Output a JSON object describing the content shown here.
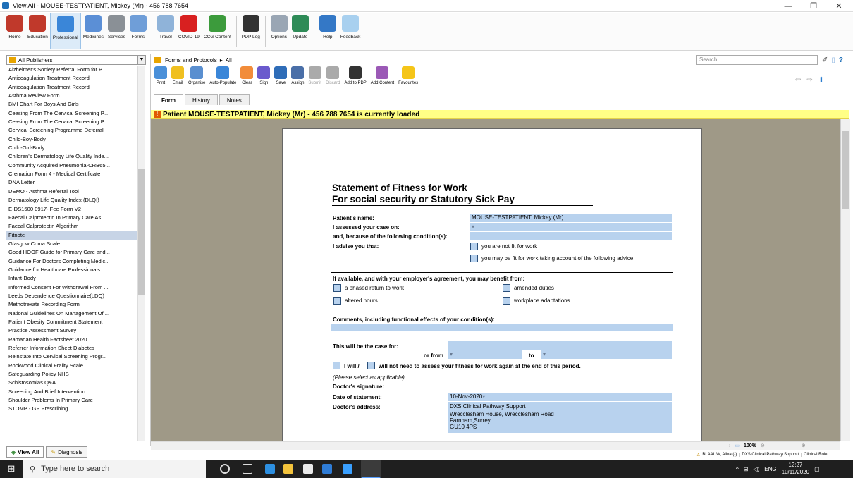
{
  "window": {
    "title": "View All  -  MOUSE-TESTPATIENT, Mickey (Mr) - 456 788 7654"
  },
  "ribbon": [
    {
      "label": "Home",
      "icon": "home-icon",
      "color": "#c0392b"
    },
    {
      "label": "Education",
      "icon": "education-icon",
      "color": "#c0392b"
    },
    {
      "label": "Professional",
      "icon": "caduceus-icon",
      "color": "#3a86d8",
      "active": true
    },
    {
      "label": "Medicines",
      "icon": "medicines-icon",
      "color": "#5b8fd6"
    },
    {
      "label": "Services",
      "icon": "ambulance-icon",
      "color": "#8a9096"
    },
    {
      "label": "Forms",
      "icon": "forms-icon",
      "color": "#6f9ed8"
    },
    {
      "label": "Travel",
      "icon": "travel-icon",
      "color": "#8fb3d9"
    },
    {
      "label": "COVID-19",
      "icon": "siren-icon",
      "color": "#d82020"
    },
    {
      "label": "CCG Content",
      "icon": "people-icon",
      "color": "#3c9b3c"
    },
    {
      "label": "PDP Log",
      "icon": "graduate-icon",
      "color": "#333333"
    },
    {
      "label": "Options",
      "icon": "tools-icon",
      "color": "#9aa6b4"
    },
    {
      "label": "Update",
      "icon": "update-icon",
      "color": "#2e8b57"
    },
    {
      "label": "Help",
      "icon": "help-icon",
      "color": "#3478c6"
    },
    {
      "label": "Feedback",
      "icon": "feedback-icon",
      "color": "#a8d0ef"
    }
  ],
  "left": {
    "publisher": "All Publishers",
    "forms": [
      "Alzheimer's Society Referral Form for P...",
      "Anticoagulation Treatment Record",
      "Anticoagulation Treatment Record",
      "Asthma Review Form",
      "BMI Chart For Boys And Girls",
      "Ceasing From The Cervical Screening P...",
      "Ceasing From The Cervical Screening P...",
      "Cervical Screening Programme Deferral",
      "Child-Boy-Body",
      "Child-Girl-Body",
      "Children's Dermatology Life Quality Inde...",
      "Community Acquired Pneumonia-CRB65...",
      "Cremation Form 4 - Medical Certificate",
      "DNA Letter",
      "DEMO - Asthma Referral Tool",
      "Dermatology Life Quality Index (DLQI)",
      "E-DS1500 0917- Fee Form V2",
      "Faecal Calprotectin In Primary Care As ...",
      "Faecal Calprotectin Algorithm",
      "Fitnote",
      "Glasgow Coma Scale",
      "Good HOOF Guide for Primary Care and...",
      "Guidance For Doctors Completing Medic...",
      "Guidance for Healthcare Professionals ...",
      "Infant-Body",
      "Informed Consent For Withdrawal From ...",
      "Leeds Dependence Questionnaire(LDQ)",
      "Methotrexate Recording Form",
      "National Guidelines On Management Of ...",
      "Patient Obesity Commitment Statement",
      "Practice Assessment Survey",
      "Ramadan Health Factsheet 2020",
      "Referrer Information Sheet Diabetes",
      "Reinstate Into Cervical Screening Progr...",
      "Rockwood Clinical Frailty Scale",
      "Safeguarding Policy NHS",
      "Schistosomias Q&A",
      "Screening And Brief Intervention",
      "Shoulder Problems In Primary Care",
      "STOMP - GP Prescribing"
    ],
    "selected_index": 19,
    "tabs": [
      "View All",
      "Diagnosis"
    ]
  },
  "breadcrumb": {
    "root": "Forms and Protocols",
    "sep": "▸",
    "leaf": "All"
  },
  "search": {
    "placeholder": "Search"
  },
  "toolbar": [
    "Print",
    "Email",
    "Organise",
    "Auto-Populate",
    "Clear",
    "Sign",
    "Save",
    "Assign",
    "Submit",
    "Discard",
    "Add to PDP",
    "Add Content",
    "Favourites"
  ],
  "form_tabs": [
    "Form",
    "History",
    "Notes"
  ],
  "banner": "Patient MOUSE-TESTPATIENT, Mickey (Mr) - 456 788 7654 is currently loaded",
  "doc": {
    "title1": "Statement of Fitness for Work",
    "title2": "For social security or Statutory Sick Pay",
    "patient_name_label": "Patient's name:",
    "patient_name": "MOUSE-TESTPATIENT, Mickey (Mr)",
    "assessed_label": "I assessed your case on:",
    "because_label": "and, because of the following condition(s):",
    "advise_label": "I advise you that:",
    "not_fit": "you are not fit for work",
    "may_be_fit": "you may be fit for work taking account of the following advice:",
    "benefit_label": "If available, and with your employer's agreement, you may benefit from:",
    "phased": "a phased return to work",
    "amended": "amended duties",
    "altered": "altered hours",
    "adaptations": "workplace adaptations",
    "comments_label": "Comments, including functional effects of your condition(s):",
    "case_for": "This will be the case for:",
    "or_from": "or from",
    "to": "to",
    "will_a": "I will /",
    "will_b": "will not need to assess your fitness for work again at the end of this period.",
    "select": "(Please select as applicable)",
    "signature": "Doctor's signature:",
    "date_label": "Date of statement:",
    "date_value": "10-Nov-2020",
    "address_label": "Doctor's address:",
    "address": [
      "DXS Clinical Pathway Support",
      "Wrecclesham House, Wrecclesham Road",
      "Farnham,Surrey",
      "GU10 4PS"
    ]
  },
  "zoom": "100%",
  "status": [
    "BLAAUW, Alina (-)",
    "DXS Clinical Pathway Support",
    "Clinical Role"
  ],
  "taskbar": {
    "search_placeholder": "Type here to search",
    "lang": "ENG",
    "time": "12:27",
    "date": "10/11/2020"
  }
}
